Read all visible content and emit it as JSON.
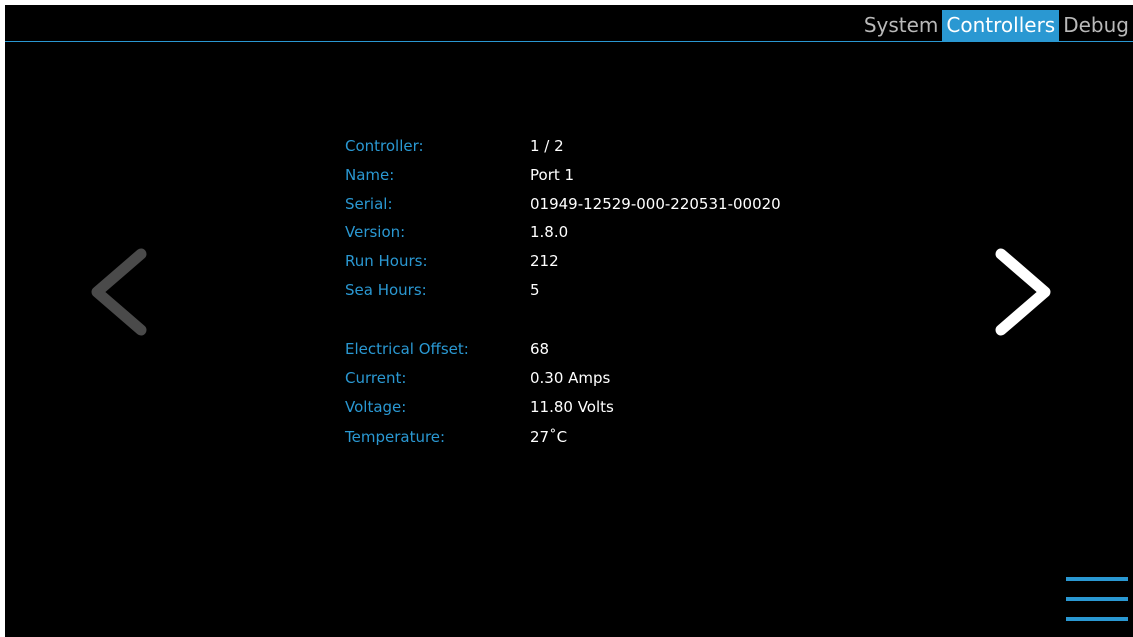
{
  "tabs": [
    {
      "label": "System",
      "active": false
    },
    {
      "label": "Controllers",
      "active": true
    },
    {
      "label": "Debug",
      "active": false
    }
  ],
  "controller_info": [
    {
      "label": "Controller:",
      "value": "1 / 2"
    },
    {
      "label": "Name:",
      "value": "Port 1"
    },
    {
      "label": "Serial:",
      "value": "01949-12529-000-220531-00020"
    },
    {
      "label": "Version:",
      "value": "1.8.0"
    },
    {
      "label": "Run Hours:",
      "value": "212"
    },
    {
      "label": "Sea Hours:",
      "value": "5"
    }
  ],
  "electrical_info": [
    {
      "label": "Electrical Offset:",
      "value": "68"
    },
    {
      "label": "Current:",
      "value": "0.30 Amps"
    },
    {
      "label": "Voltage:",
      "value": "11.80 Volts"
    },
    {
      "label": "Temperature:",
      "value": "27˚C"
    }
  ],
  "icons": {
    "prev": "chevron-left-icon",
    "next": "chevron-right-icon",
    "menu": "hamburger-menu-icon"
  },
  "colors": {
    "accent": "#2a98d2",
    "background": "#000000",
    "value_text": "#ffffff",
    "inactive_tab": "#b9b9b9",
    "disabled_arrow": "#4a4a4a"
  }
}
